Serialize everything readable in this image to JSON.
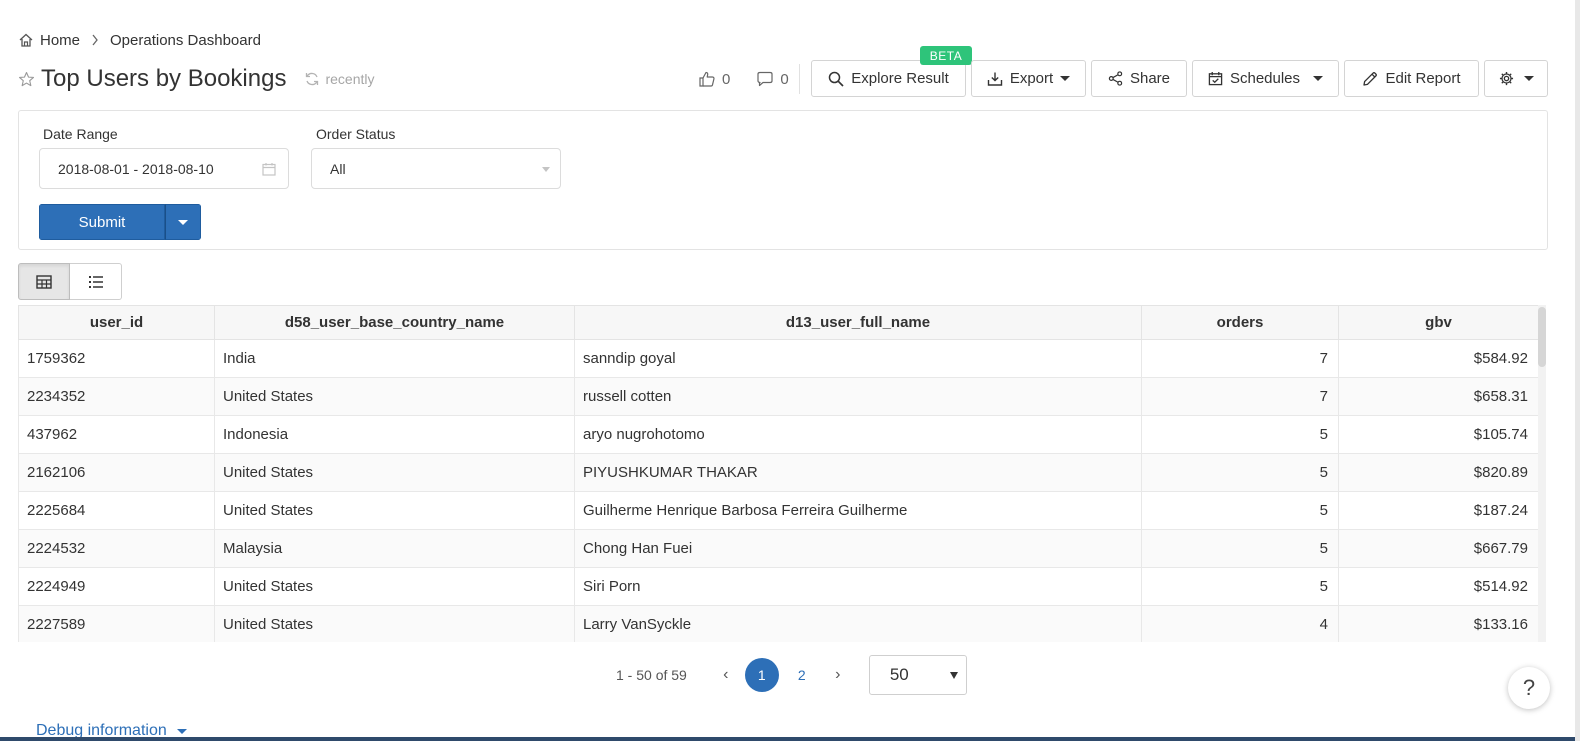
{
  "breadcrumb": {
    "home": "Home",
    "current": "Operations Dashboard"
  },
  "header": {
    "title": "Top Users by Bookings",
    "refresh_text": "recently",
    "likes": "0",
    "comments": "0",
    "buttons": {
      "explore": "Explore Result",
      "beta": "BETA",
      "export": "Export",
      "share": "Share",
      "schedules": "Schedules",
      "edit": "Edit Report"
    }
  },
  "filters": {
    "date_range": {
      "label": "Date Range",
      "value": "2018-08-01 - 2018-08-10"
    },
    "order_status": {
      "label": "Order Status",
      "value": "All"
    },
    "submit": "Submit"
  },
  "table": {
    "columns": [
      "user_id",
      "d58_user_base_country_name",
      "d13_user_full_name",
      "orders",
      "gbv"
    ],
    "rows": [
      [
        "1759362",
        "India",
        "sanndip goyal",
        "7",
        "$584.92"
      ],
      [
        "2234352",
        "United States",
        "russell cotten",
        "7",
        "$658.31"
      ],
      [
        "437962",
        "Indonesia",
        "aryo nugrohotomo",
        "5",
        "$105.74"
      ],
      [
        "2162106",
        "United States",
        "PIYUSHKUMAR THAKAR",
        "5",
        "$820.89"
      ],
      [
        "2225684",
        "United States",
        "Guilherme Henrique Barbosa Ferreira Guilherme",
        "5",
        "$187.24"
      ],
      [
        "2224532",
        "Malaysia",
        "Chong Han Fuei",
        "5",
        "$667.79"
      ],
      [
        "2224949",
        "United States",
        "Siri Porn",
        "5",
        "$514.92"
      ],
      [
        "2227589",
        "United States",
        "Larry VanSyckle",
        "4",
        "$133.16"
      ]
    ]
  },
  "pagination": {
    "range_text": "1 - 50 of 59",
    "prev": "‹",
    "next": "›",
    "pages": [
      "1",
      "2"
    ],
    "page_size": "50"
  },
  "help": "?",
  "debug": "Debug information",
  "colors": {
    "primary": "#2d6fb7",
    "beta": "#2ec47a"
  }
}
